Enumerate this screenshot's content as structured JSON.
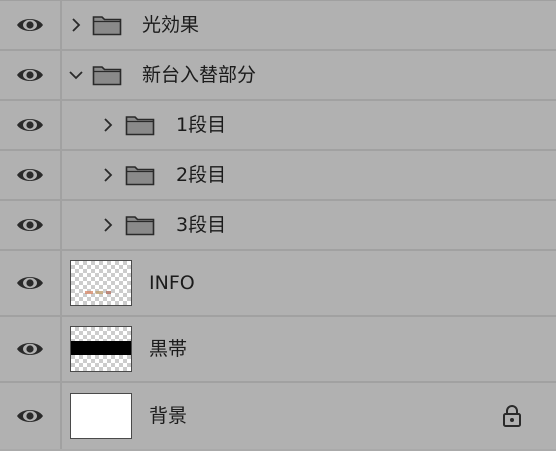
{
  "layers": [
    {
      "kind": "group",
      "name": "光効果",
      "expanded": false,
      "depth": 0,
      "visible": true
    },
    {
      "kind": "group",
      "name": "新台入替部分",
      "expanded": true,
      "depth": 0,
      "visible": true
    },
    {
      "kind": "group",
      "name": "1段目",
      "expanded": false,
      "depth": 1,
      "visible": true
    },
    {
      "kind": "group",
      "name": "2段目",
      "expanded": false,
      "depth": 1,
      "visible": true
    },
    {
      "kind": "group",
      "name": "3段目",
      "expanded": false,
      "depth": 1,
      "visible": true
    },
    {
      "kind": "layer",
      "name": "INFO",
      "thumbnail": "transparent-with-text",
      "visible": true,
      "locked": false
    },
    {
      "kind": "layer",
      "name": "黒帯",
      "thumbnail": "black-band",
      "visible": true,
      "locked": false
    },
    {
      "kind": "layer",
      "name": "背景",
      "thumbnail": "white",
      "visible": true,
      "locked": true
    }
  ],
  "icons": {
    "visibility": "eye-icon",
    "collapsed": "chevron-right-icon",
    "expanded": "chevron-down-icon",
    "group": "folder-icon",
    "lock": "lock-icon"
  },
  "colors": {
    "panel_bg": "#b1b1b1",
    "divider": "#a1a1a1",
    "text": "#1b1b1b",
    "icon": "#2a2a2a"
  }
}
